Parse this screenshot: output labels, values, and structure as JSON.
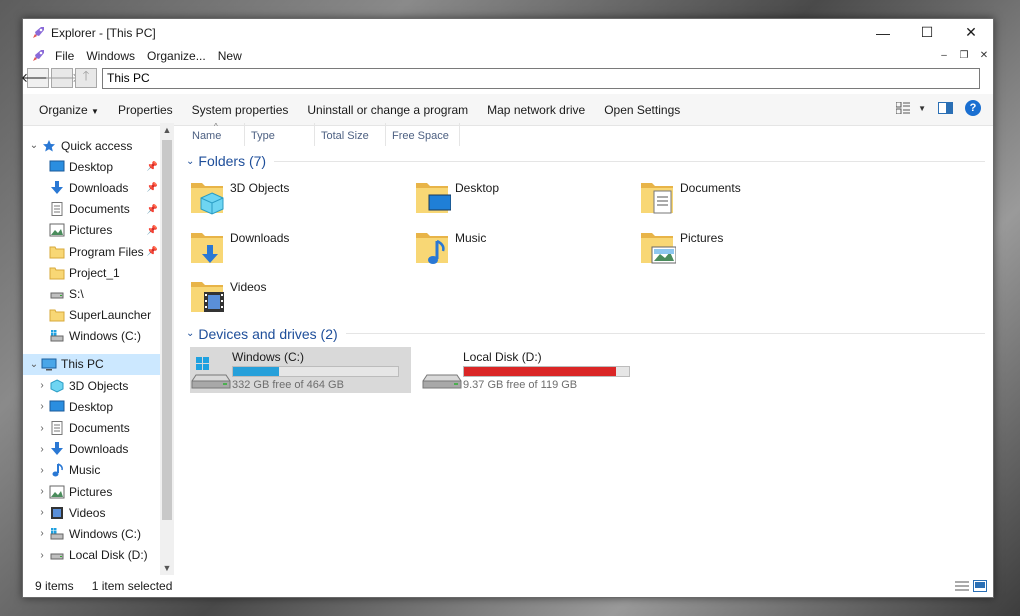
{
  "window": {
    "title": "Explorer - [This PC]"
  },
  "menubar": {
    "items": [
      "File",
      "Windows",
      "Organize...",
      "New"
    ]
  },
  "address": {
    "value": "This PC"
  },
  "toolbar": {
    "organize": "Organize",
    "properties": "Properties",
    "system_properties": "System properties",
    "uninstall": "Uninstall or change a program",
    "map_drive": "Map network drive",
    "open_settings": "Open Settings",
    "help": "?"
  },
  "navpane": {
    "quick_access": "Quick access",
    "quick_items": [
      {
        "label": "Desktop",
        "icon": "desktop-icon",
        "pinned": true
      },
      {
        "label": "Downloads",
        "icon": "downloads-icon",
        "pinned": true
      },
      {
        "label": "Documents",
        "icon": "documents-icon",
        "pinned": true
      },
      {
        "label": "Pictures",
        "icon": "pictures-icon",
        "pinned": true
      },
      {
        "label": "Program Files",
        "icon": "folder-icon",
        "pinned": true
      },
      {
        "label": "Project_1",
        "icon": "folder-icon",
        "pinned": false
      },
      {
        "label": "S:\\",
        "icon": "drive-icon",
        "pinned": false
      },
      {
        "label": "SuperLauncher",
        "icon": "folder-icon",
        "pinned": false
      },
      {
        "label": "Windows (C:)",
        "icon": "windows-drive-icon",
        "pinned": false
      }
    ],
    "this_pc": "This PC",
    "pc_items": [
      {
        "label": "3D Objects",
        "icon": "3d-objects-icon"
      },
      {
        "label": "Desktop",
        "icon": "desktop-icon"
      },
      {
        "label": "Documents",
        "icon": "documents-icon"
      },
      {
        "label": "Downloads",
        "icon": "downloads-icon"
      },
      {
        "label": "Music",
        "icon": "music-icon"
      },
      {
        "label": "Pictures",
        "icon": "pictures-icon"
      },
      {
        "label": "Videos",
        "icon": "videos-icon"
      },
      {
        "label": "Windows (C:)",
        "icon": "windows-drive-icon"
      },
      {
        "label": "Local Disk (D:)",
        "icon": "drive-icon"
      }
    ]
  },
  "columns": [
    "Name",
    "Type",
    "Total Size",
    "Free Space"
  ],
  "folders": {
    "title": "Folders (7)",
    "items": [
      {
        "label": "3D Objects",
        "icon": "3d-objects-folder-icon"
      },
      {
        "label": "Desktop",
        "icon": "desktop-folder-icon"
      },
      {
        "label": "Documents",
        "icon": "documents-folder-icon"
      },
      {
        "label": "Downloads",
        "icon": "downloads-folder-icon"
      },
      {
        "label": "Music",
        "icon": "music-folder-icon"
      },
      {
        "label": "Pictures",
        "icon": "pictures-folder-icon"
      },
      {
        "label": "Videos",
        "icon": "videos-folder-icon"
      }
    ]
  },
  "drives": {
    "title": "Devices and drives (2)",
    "items": [
      {
        "label": "Windows (C:)",
        "free": "332 GB free of 464 GB",
        "used_fraction": 0.28,
        "color": "#26a0da",
        "selected": true,
        "windows": true
      },
      {
        "label": "Local Disk (D:)",
        "free": "9.37 GB free of 119 GB",
        "used_fraction": 0.92,
        "color": "#da2626",
        "selected": false,
        "windows": false
      }
    ]
  },
  "status": {
    "items": "9 items",
    "selected": "1 item selected"
  },
  "colors": {
    "accent": "#1e4e9a",
    "selection": "#cce8ff",
    "c_bar": "#26a0da",
    "d_bar": "#da2626"
  }
}
